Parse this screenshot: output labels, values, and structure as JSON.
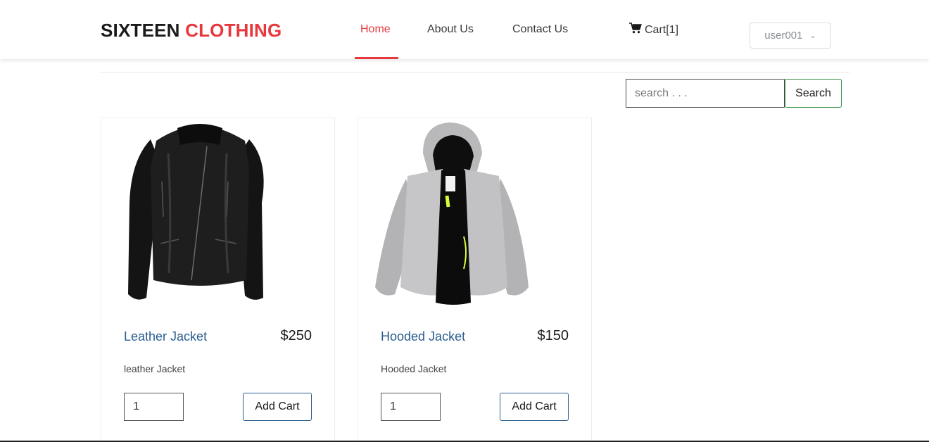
{
  "brand": {
    "part1": "SIXTEEN",
    "part2": "CLOTHING",
    "accent_color": "#e8383d"
  },
  "nav": {
    "home": "Home",
    "about": "About Us",
    "contact": "Contact Us",
    "cart": "Cart[1]",
    "cart_icon": "shopping-cart-icon"
  },
  "user_menu": {
    "label": "user001",
    "icon": "chevron-down-icon"
  },
  "search": {
    "placeholder": "search . . .",
    "button": "Search"
  },
  "products": [
    {
      "name": "Leather Jacket",
      "price": "$250",
      "description": "leather Jacket",
      "quantity": "1",
      "button": "Add Cart"
    },
    {
      "name": "Hooded Jacket",
      "price": "$150",
      "description": "Hooded Jacket",
      "quantity": "1",
      "button": "Add Cart"
    }
  ]
}
